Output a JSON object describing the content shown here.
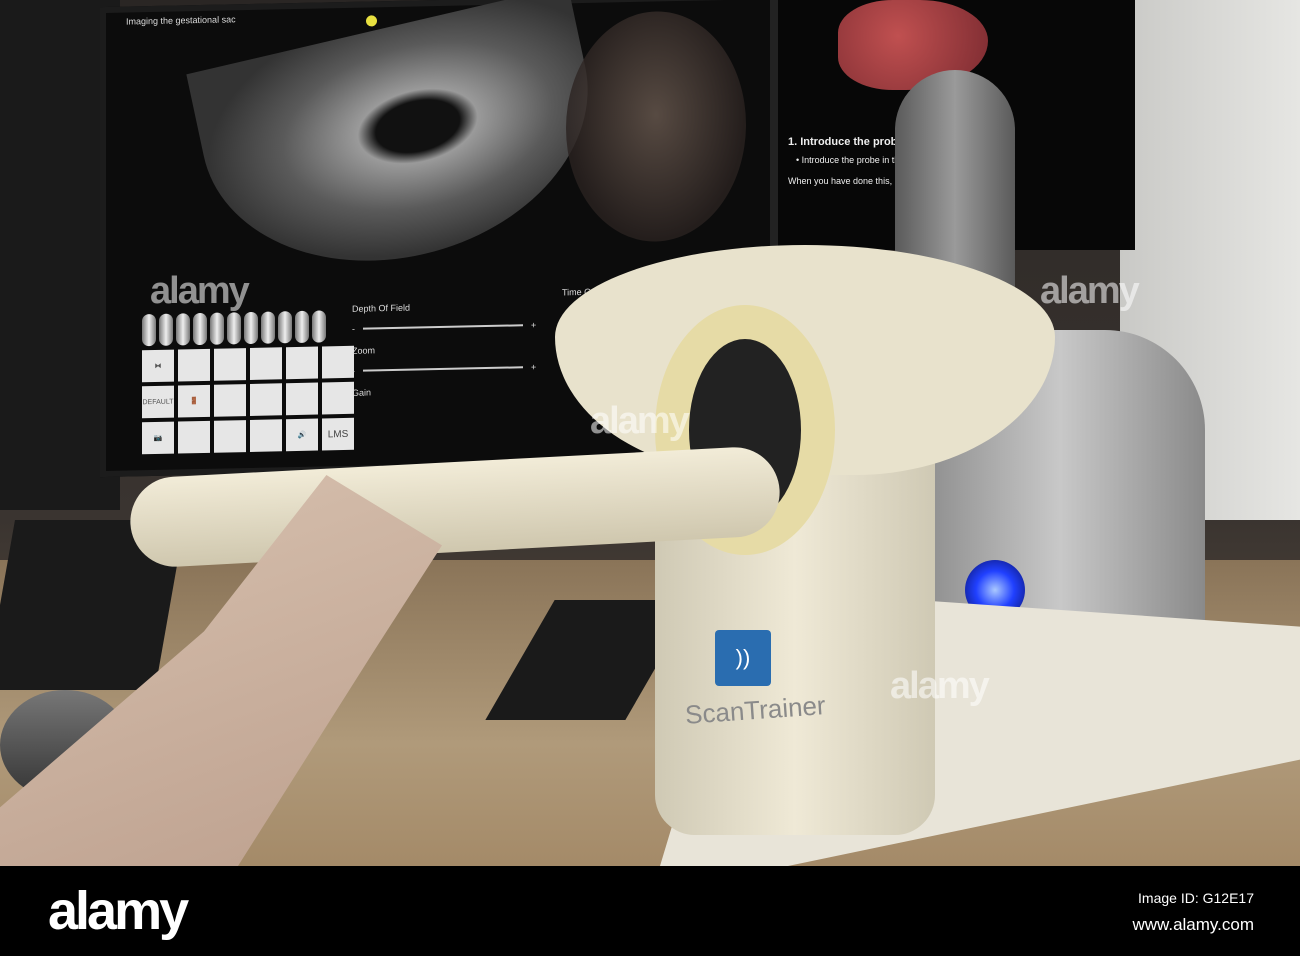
{
  "screen": {
    "title": "Imaging the gestational sac",
    "controls": {
      "depth_of_field": "Depth Of Field",
      "zoom": "Zoom",
      "gain": "Gain",
      "tgc": "Time Gain Compensation",
      "default_btn": "DEFAULT",
      "lms_btn": "LMS",
      "minus": "-",
      "plus": "+"
    }
  },
  "instructions": {
    "heading": "1. Introduce the probe",
    "bullet": "• Introduce the probe in the",
    "followup": "When you have done this, click"
  },
  "device": {
    "brand": "ScanTrainer"
  },
  "watermark": {
    "text": "alamy",
    "image_id": "Image ID: G12E17",
    "url": "www.alamy.com"
  },
  "colors": {
    "led": "#2040ff",
    "brand_blue": "#2a6db0",
    "probe_ring": "#e6dba6"
  }
}
